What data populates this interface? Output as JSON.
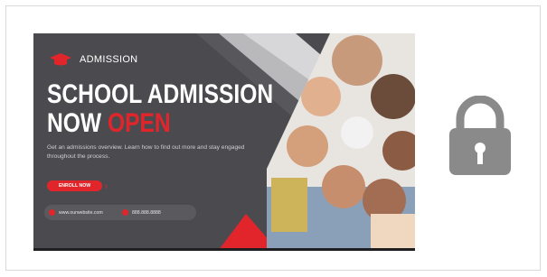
{
  "banner": {
    "badge_label": "ADMISSION",
    "headline_line1": "SCHOOL ADMISSION",
    "headline_line2_a": "NOW ",
    "headline_line2_b": "OPEN",
    "description": "Get an admissions overview. Learn how to find out more and stay engaged throughout the process.",
    "enroll_label": "ENROLL NOW",
    "website": "www.ourwebsite.com",
    "phone": "888.888.8888"
  },
  "colors": {
    "accent": "#e2252b",
    "banner_bg": "#4a4a4e",
    "lock": "#8a8a8a"
  },
  "icons": {
    "badge": "graduation-cap-icon",
    "lock": "lock-icon"
  }
}
